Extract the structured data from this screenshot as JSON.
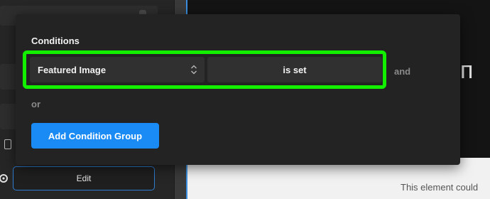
{
  "popover": {
    "title": "Conditions",
    "condition": {
      "field": "Featured Image",
      "operator": "is set",
      "connector": "and"
    },
    "or_label": "or",
    "add_group_label": "Add Condition Group"
  },
  "editor": {
    "edit_label": "Edit"
  },
  "canvas": {
    "glyph_text": "ѕп",
    "notice_text": "This element could"
  },
  "colors": {
    "highlight": "#12f000",
    "primary_button": "#1a8af4",
    "focus_border": "#2d7dd2",
    "popover_bg": "#232323"
  }
}
